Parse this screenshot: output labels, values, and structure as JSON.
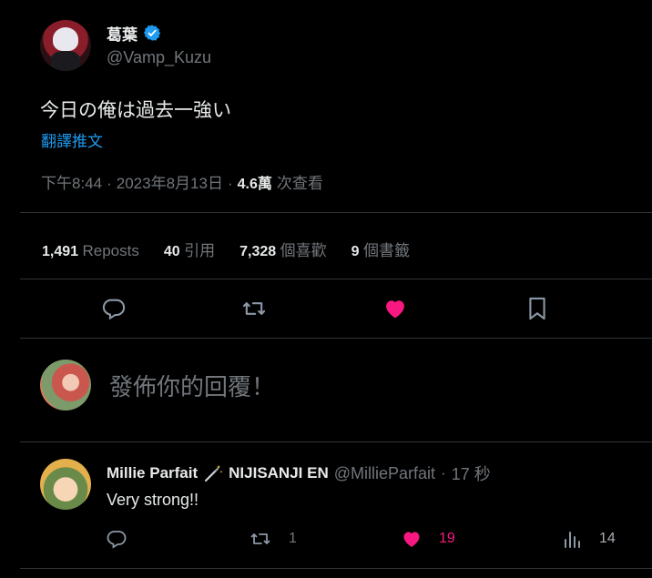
{
  "tweet": {
    "author_name": "葛葉",
    "author_handle": "@Vamp_Kuzu",
    "text": "今日の俺は過去一強い",
    "translate_link": "翻譯推文",
    "time": "下午8:44",
    "sep1": "·",
    "date": "2023年8月13日",
    "sep2": "·",
    "views_count": "4.6萬",
    "views_label": "次查看"
  },
  "stats": {
    "reposts_count": "1,491",
    "reposts_label": "Reposts",
    "quotes_count": "40",
    "quotes_label": "引用",
    "likes_count": "7,328",
    "likes_label": "個喜歡",
    "bookmarks_count": "9",
    "bookmarks_label": "個書籤"
  },
  "reply_box": {
    "placeholder": "發佈你的回覆！"
  },
  "reply": {
    "author_name": "Millie Parfait",
    "author_suffix": "NIJISANJI EN",
    "handle": "@MillieParfait",
    "sep": "·",
    "time": "17 秒",
    "text": "Very strong!!",
    "reposts": "1",
    "likes": "19",
    "views": "14"
  },
  "colors": {
    "verified": "#1d9bf0",
    "like": "#f91880",
    "link": "#1d9bf0",
    "text": "#e7e9ea",
    "muted": "#71767b",
    "divider": "#2f3336"
  }
}
